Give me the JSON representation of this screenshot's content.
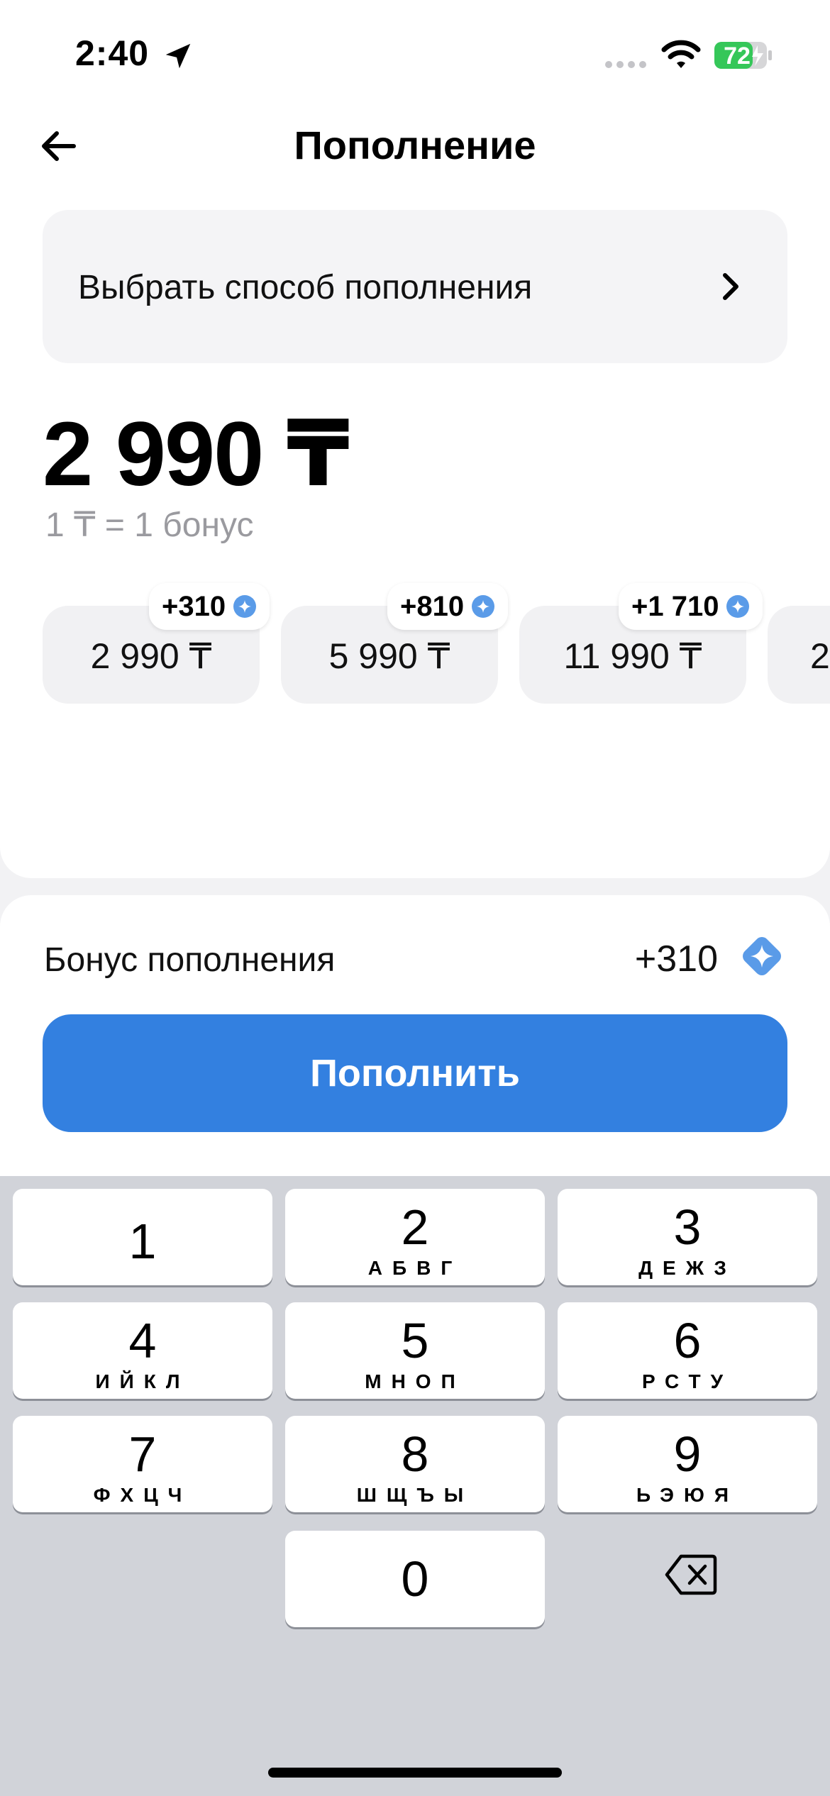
{
  "status_bar": {
    "time": "2:40",
    "battery": "72"
  },
  "header": {
    "title": "Пополнение"
  },
  "method": {
    "label": "Выбрать способ пополнения"
  },
  "amount": {
    "value": "2 990 ₸",
    "rate": "1 ₸ = 1 бонус"
  },
  "presets": [
    {
      "amount": "2 990 ₸",
      "bonus": "+310"
    },
    {
      "amount": "5 990 ₸",
      "bonus": "+810"
    },
    {
      "amount": "11 990 ₸",
      "bonus": "+1 710"
    },
    {
      "amount": "2"
    }
  ],
  "bonus": {
    "label": "Бонус пополнения",
    "value": "+310"
  },
  "action": {
    "label": "Пополнить"
  },
  "keypad": [
    {
      "digit": "1",
      "letters": ""
    },
    {
      "digit": "2",
      "letters": "АБВГ"
    },
    {
      "digit": "3",
      "letters": "ДЕЖЗ"
    },
    {
      "digit": "4",
      "letters": "ИЙКЛ"
    },
    {
      "digit": "5",
      "letters": "МНОП"
    },
    {
      "digit": "6",
      "letters": "РСТУ"
    },
    {
      "digit": "7",
      "letters": "ФХЦЧ"
    },
    {
      "digit": "8",
      "letters": "ШЩЪЫ"
    },
    {
      "digit": "9",
      "letters": "ЬЭЮЯ"
    },
    {
      "digit": "0",
      "letters": ""
    }
  ],
  "colors": {
    "accent": "#3380e0",
    "bonus_icon": "#5a9be8"
  }
}
